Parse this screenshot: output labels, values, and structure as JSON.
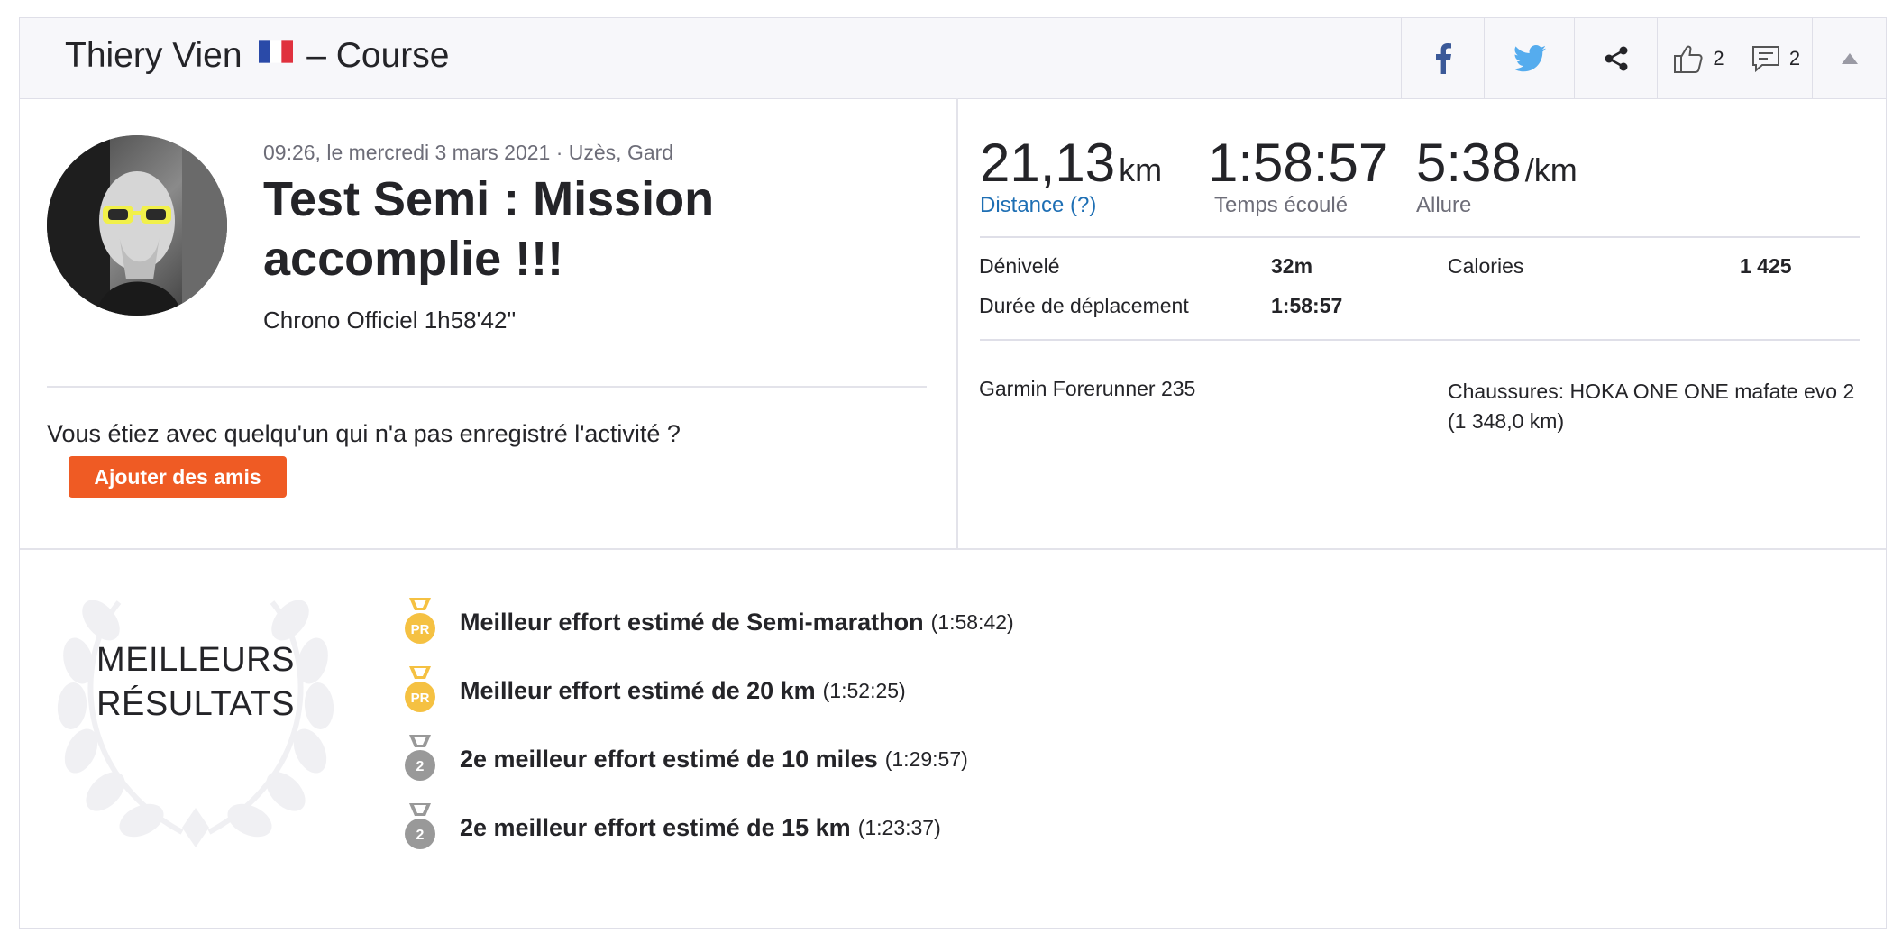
{
  "header": {
    "athlete_name": "Thiery Vien",
    "separator_title": "– Course",
    "kudos_count": "2",
    "comment_count": "2"
  },
  "icons": {
    "flag": "france-flag-icon",
    "facebook": "facebook-icon",
    "twitter": "twitter-icon",
    "share": "share-icon",
    "kudos": "thumbs-up-icon",
    "comment": "comment-icon",
    "collapse": "caret-up-icon"
  },
  "colors": {
    "facebook": "#3b5998",
    "twitter": "#55acee",
    "accent": "#ef5b24",
    "link": "#1e6fb4",
    "gold_medal": "#f5c142",
    "silver_medal": "#999999"
  },
  "activity": {
    "meta": "09:26, le mercredi 3 mars 2021 · Uzès, Gard",
    "title": "Test Semi : Mission accomplie !!!",
    "description": "Chrono Officiel 1h58'42''",
    "with_someone_prompt": "Vous étiez avec quelqu'un qui n'a pas enregistré l'activité ?",
    "add_friends_label": "Ajouter des amis"
  },
  "primary_stats": [
    {
      "value": "21,13",
      "unit": "km",
      "label": "Distance (?)"
    },
    {
      "value": "1:58:57",
      "unit": "",
      "label": "Temps écoulé"
    },
    {
      "value": "5:38",
      "unit": "/km",
      "label": "Allure"
    }
  ],
  "secondary_stats": {
    "elevation_label": "Dénivelé",
    "elevation_value": "32m",
    "calories_label": "Calories",
    "calories_value": "1 425",
    "moving_time_label": "Durée de déplacement",
    "moving_time_value": "1:58:57"
  },
  "gear": {
    "device": "Garmin Forerunner 235",
    "shoes": "Chaussures: HOKA ONE ONE mafate evo 2 (1 348,0 km)"
  },
  "best_efforts": {
    "heading_line1": "MEILLEURS",
    "heading_line2": "RÉSULTATS",
    "items": [
      {
        "medal": "PR",
        "name": "Meilleur effort estimé de Semi-marathon",
        "time": "(1:58:42)"
      },
      {
        "medal": "PR",
        "name": "Meilleur effort estimé de 20 km",
        "time": "(1:52:25)"
      },
      {
        "medal": "2",
        "name": "2e meilleur effort estimé de 10 miles",
        "time": "(1:29:57)"
      },
      {
        "medal": "2",
        "name": "2e meilleur effort estimé de 15 km",
        "time": "(1:23:37)"
      }
    ]
  }
}
